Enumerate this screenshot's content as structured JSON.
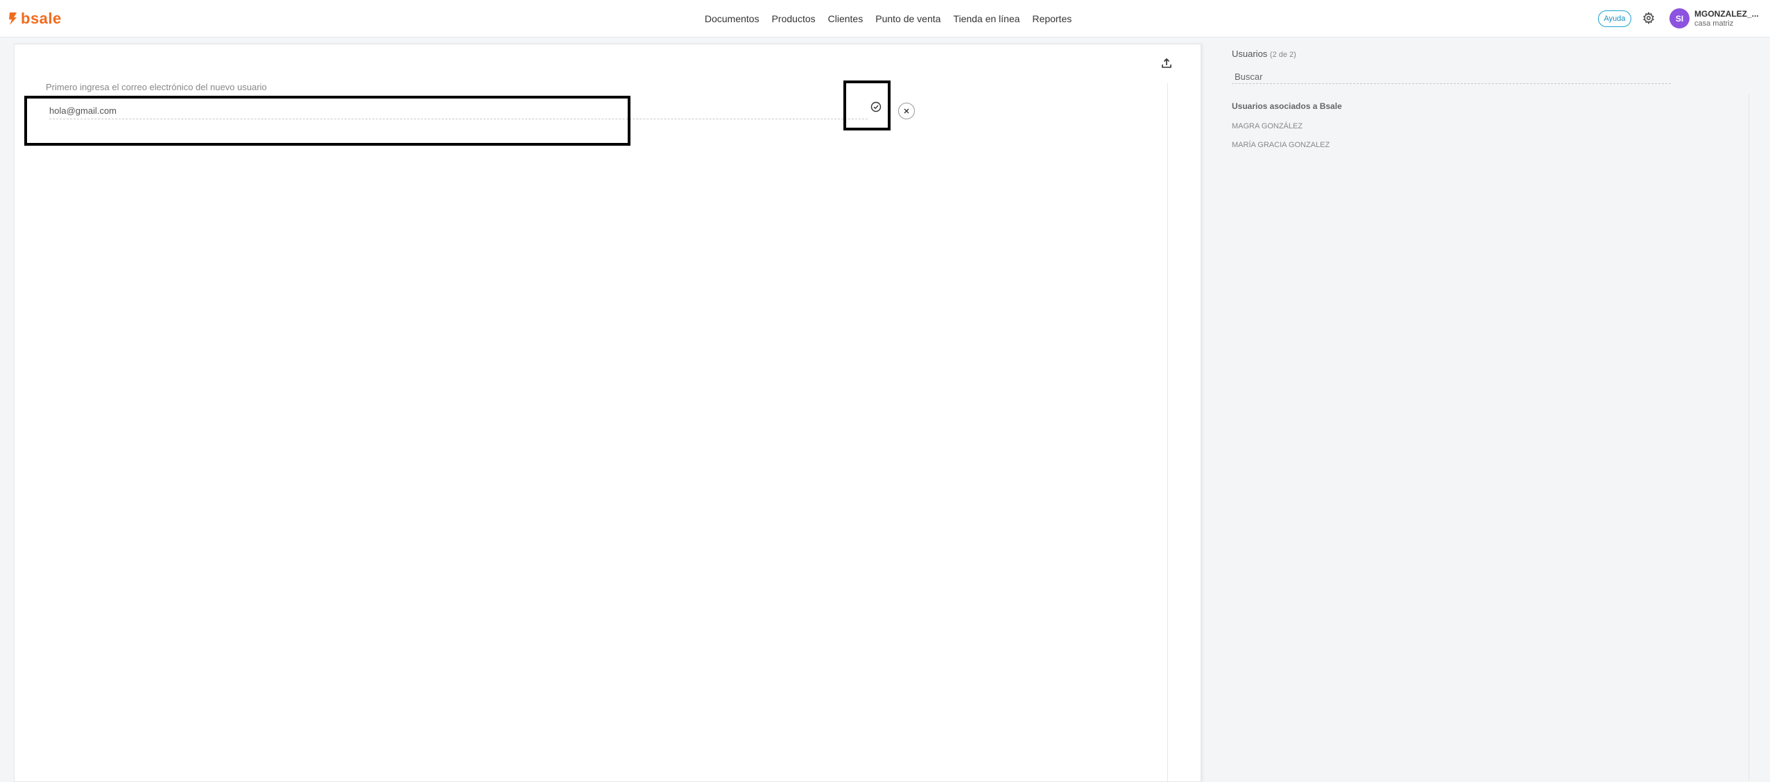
{
  "brand": {
    "logo_text": "bsale",
    "color": "#f26b1d"
  },
  "nav": {
    "items": [
      "Documentos",
      "Productos",
      "Clientes",
      "Punto de venta",
      "Tienda en línea",
      "Reportes"
    ]
  },
  "header": {
    "help_label": "Ayuda",
    "avatar_initials": "SI",
    "user_name": "MGONZALEZ_...",
    "user_sub": "casa matriz"
  },
  "form": {
    "label": "Primero ingresa el correo electrónico del nuevo usuario",
    "email_value": "hola@gmail.com"
  },
  "sidebar": {
    "title": "Usuarios",
    "count": "(2 de 2)",
    "search_placeholder": "Buscar",
    "group_title": "Usuarios asociados a Bsale",
    "users": [
      "MAGRA GONZÁLEZ",
      "MARÍA GRACIA GONZALEZ"
    ]
  },
  "icons": {
    "upload": "upload-icon",
    "confirm": "check-circle-icon",
    "cancel": "close-icon",
    "settings": "gear-icon"
  }
}
